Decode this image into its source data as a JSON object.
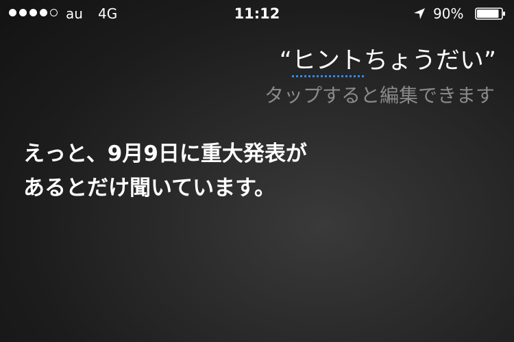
{
  "status_bar": {
    "signal_strength": "4/5",
    "carrier": "au",
    "network": "4G",
    "time": "11:12",
    "location_icon": "location-arrow-icon",
    "battery_percent": "90%",
    "battery_level": 0.9,
    "battery_icon": "battery-icon"
  },
  "siri": {
    "request_open_quote": "“",
    "request_highlight": "ヒント",
    "request_rest": "ちょうだい",
    "request_close_quote": "”",
    "highlight_color": "#2f8cff",
    "edit_hint": "タップすると編集できます",
    "response_line1": "えっと、9月9日に重大発表が",
    "response_line2": "あるとだけ聞いています。"
  }
}
